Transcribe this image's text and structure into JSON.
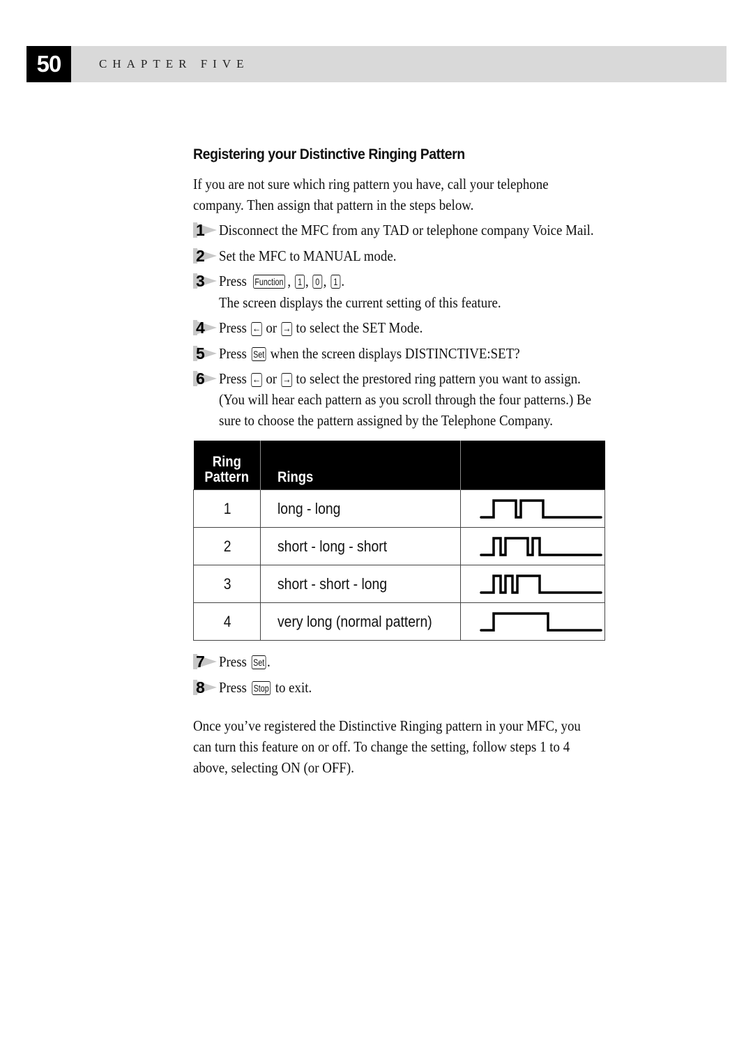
{
  "header": {
    "page_number": "50",
    "chapter": "CHAPTER FIVE"
  },
  "section": {
    "title": "Registering your Distinctive Ringing Pattern",
    "intro": [
      "If you are not sure which ring pattern you have, call your telephone",
      "company. Then assign that pattern in the steps below."
    ]
  },
  "steps": [
    {
      "num": "1",
      "text": "Disconnect the MFC from any TAD or telephone company Voice Mail."
    },
    {
      "num": "2",
      "text": "Set the MFC to MANUAL mode."
    },
    {
      "num": "3",
      "pre": "Press",
      "keys": [
        "Function",
        "1",
        "0",
        "1"
      ],
      "sub": "The screen displays the current setting of this feature."
    },
    {
      "num": "4",
      "pre": "Press",
      "key_left": "←",
      "mid": "or",
      "key_right": "→",
      "post": "to select the SET Mode."
    },
    {
      "num": "5",
      "pre": "Press",
      "key": "Set",
      "post": "when the screen displays DISTINCTIVE:SET?"
    },
    {
      "num": "6",
      "pre": "Press",
      "key_left": "←",
      "mid": "or",
      "key_right": "→",
      "post": "to select the prestored ring pattern you want to assign.",
      "lines": [
        "(You will hear each pattern as you scroll through the four patterns.) Be",
        "sure to choose the pattern assigned by the Telephone Company."
      ]
    },
    {
      "num": "7",
      "pre": "Press",
      "key": "Set",
      "post": "."
    },
    {
      "num": "8",
      "pre": "Press",
      "key": "Stop",
      "post": "to exit."
    }
  ],
  "table": {
    "headers": {
      "pattern_line1": "Ring",
      "pattern_line2": "Pattern",
      "rings": "Rings",
      "waveform": ""
    },
    "rows": [
      {
        "pattern": "1",
        "rings": "long - long",
        "wave": [
          "long",
          "long"
        ]
      },
      {
        "pattern": "2",
        "rings": "short - long - short",
        "wave": [
          "short",
          "long",
          "short"
        ]
      },
      {
        "pattern": "3",
        "rings": "short - short - long",
        "wave": [
          "short",
          "short",
          "long"
        ]
      },
      {
        "pattern": "4",
        "rings": "very long (normal pattern)",
        "wave": [
          "verylong"
        ]
      }
    ]
  },
  "closing": [
    "Once you’ve registered the Distinctive Ringing pattern in your MFC, you",
    "can turn this feature on or off.  To change the setting, follow steps 1 to 4",
    "above, selecting ON (or OFF)."
  ]
}
